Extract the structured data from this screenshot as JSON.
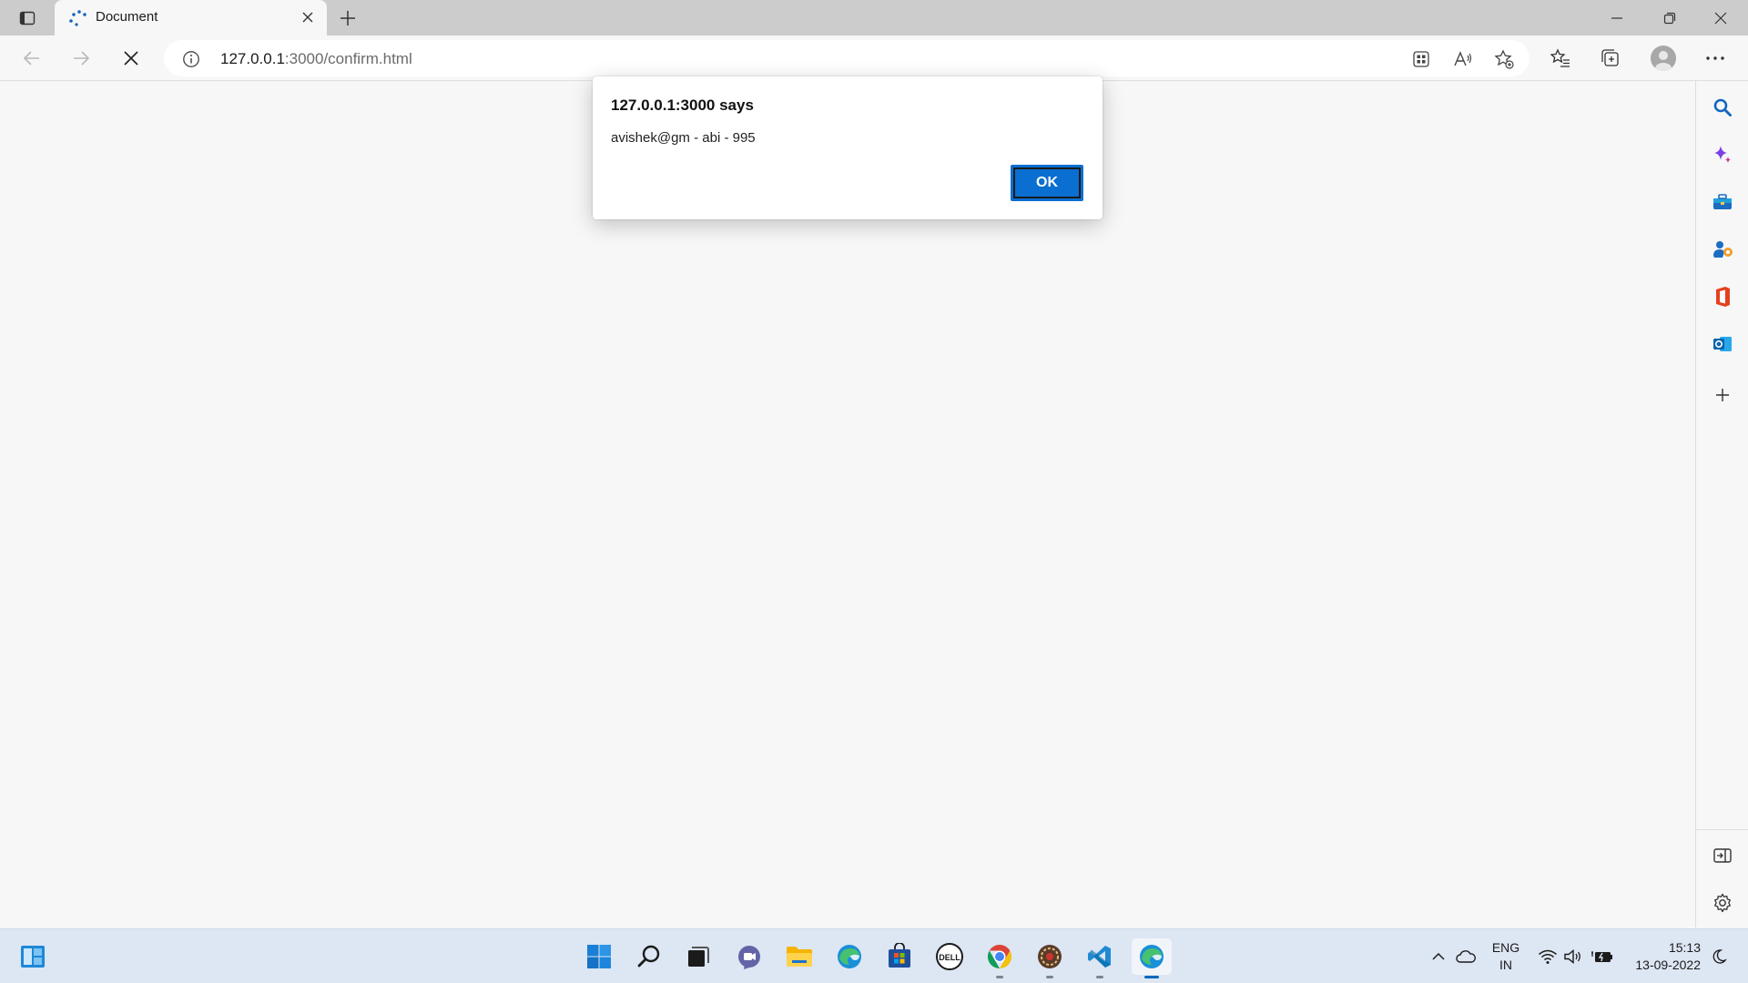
{
  "browser": {
    "tab": {
      "title": "Document"
    },
    "address": {
      "host": "127.0.0.1",
      "path": ":3000/confirm.html"
    }
  },
  "dialog": {
    "title": "127.0.0.1:3000 says",
    "message": "avishek@gm - abi - 995",
    "ok_label": "OK"
  },
  "sidebar": {
    "icons": [
      "search-icon",
      "copilot-icon",
      "tools-icon",
      "games-icon",
      "office-icon",
      "outlook-icon",
      "add-icon",
      "sidebar-collapse-icon",
      "settings-icon"
    ]
  },
  "taskbar": {
    "apps": [
      "start-icon",
      "search-icon",
      "task-view-icon",
      "chat-icon",
      "file-explorer-icon",
      "edge-icon",
      "store-icon",
      "dell-icon",
      "chrome-icon",
      "app-icon",
      "vscode-icon",
      "edge-dev-icon"
    ],
    "language": {
      "line1": "ENG",
      "line2": "IN"
    },
    "clock": {
      "time": "15:13",
      "date": "13-09-2022"
    }
  },
  "colors": {
    "accent": "#0a6fd0",
    "page_bg": "#f7f7f7",
    "titlebar_bg": "#cccccc",
    "taskbar_bg": "#dde6f3"
  }
}
